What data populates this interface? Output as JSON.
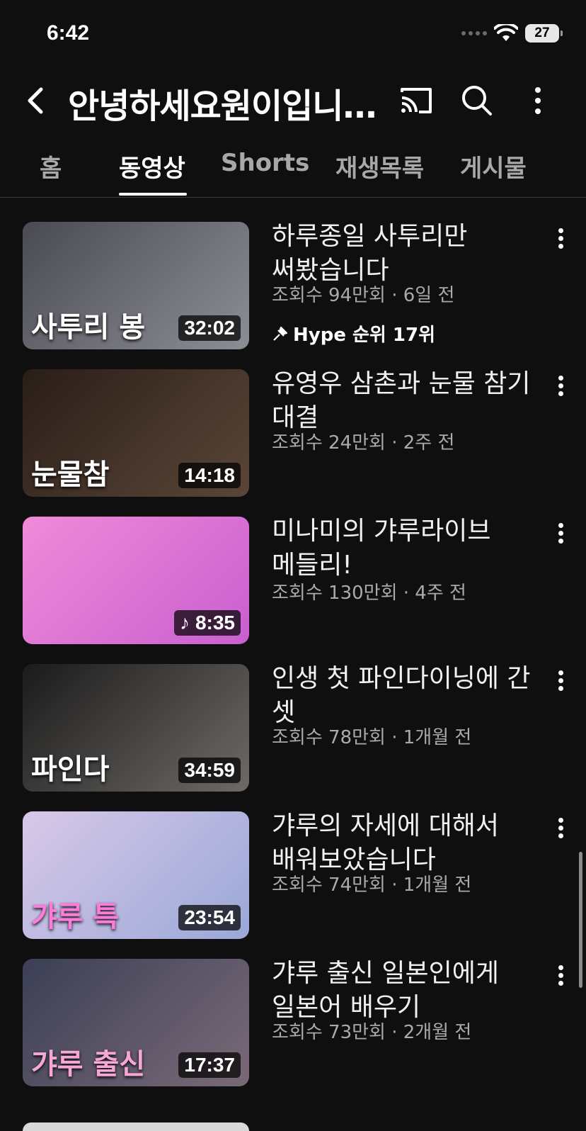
{
  "status_bar": {
    "time": "6:42",
    "battery": "27"
  },
  "header": {
    "channel_title": "안녕하세요원이입니…",
    "icons": [
      "back-icon",
      "cast-icon",
      "search-icon",
      "more-vert-icon"
    ]
  },
  "tabs": [
    {
      "label": "홈",
      "active": false
    },
    {
      "label": "동영상",
      "active": true
    },
    {
      "label": "Shorts",
      "active": false
    },
    {
      "label": "재생목록",
      "active": false
    },
    {
      "label": "게시물",
      "active": false
    }
  ],
  "videos": [
    {
      "title": "하루종일 사투리만 써봤습니다",
      "meta": "조회수 94만회 · 6일 전",
      "duration": "32:02",
      "caption": "사투리 봉",
      "hype": "Hype 순위 17위",
      "colors": [
        "#4a4a52",
        "#8c8e96"
      ]
    },
    {
      "title": "유영우 삼촌과 눈물 참기 대결",
      "meta": "조회수 24만회 · 2주 전",
      "duration": "14:18",
      "caption": "눈물참",
      "colors": [
        "#2a1e18",
        "#5a4638"
      ]
    },
    {
      "title": "미나미의 갸루라이브 메들리!",
      "meta": "조회수 130만회 · 4주 전",
      "duration": "8:35",
      "caption": "",
      "music": true,
      "colors": [
        "#f08ad8",
        "#c95fd0"
      ]
    },
    {
      "title": "인생 첫 파인다이닝에 간 셋",
      "meta": "조회수 78만회 · 1개월 전",
      "duration": "34:59",
      "caption": "파인다",
      "colors": [
        "#1b1b1b",
        "#6e6a66"
      ]
    },
    {
      "title": "갸루의 자세에 대해서 배워보았습니다",
      "meta": "조회수 74만회 · 1개월 전",
      "duration": "23:54",
      "caption": "갸루 특",
      "colors": [
        "#d8c8e8",
        "#9aa8d8"
      ]
    },
    {
      "title": "갸루 출신 일본인에게 일본어 배우기",
      "meta": "조회수 73만회 · 2개월 전",
      "duration": "17:37",
      "caption": "갸루 출신",
      "colors": [
        "#3b3f55",
        "#7a6a78"
      ]
    }
  ]
}
